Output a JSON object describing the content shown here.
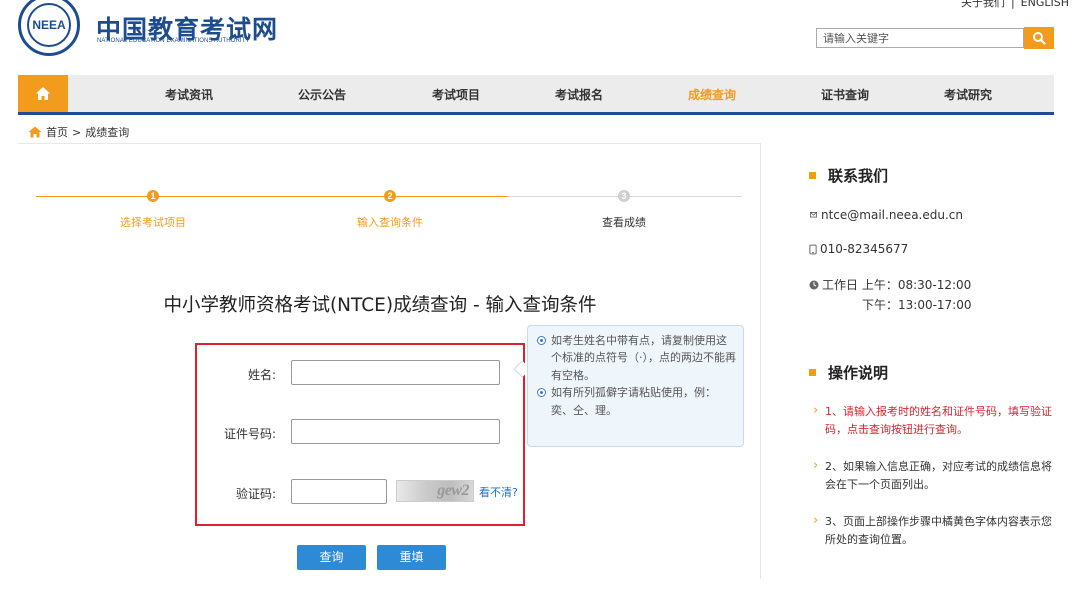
{
  "header": {
    "top_links": [
      "关于我们",
      "ENGLISH"
    ],
    "top_sep": "|",
    "logo_text": "NEEA",
    "site_title": "中国教育考试网",
    "site_subtitle": "NATIONAL EDUCATION EXAMINATIONS AUTHORITY",
    "search_placeholder": "请输入关键字"
  },
  "nav": {
    "items": [
      {
        "label": "考试资讯"
      },
      {
        "label": "公示公告"
      },
      {
        "label": "考试项目"
      },
      {
        "label": "考试报名"
      },
      {
        "label": "成绩查询"
      },
      {
        "label": "证书查询"
      },
      {
        "label": "考试研究"
      }
    ],
    "active": "成绩查询"
  },
  "breadcrumb": {
    "home": "首页",
    "sep": ">",
    "current": "成绩查询"
  },
  "steps": [
    {
      "num": "1",
      "label": "选择考试项目",
      "state": "done"
    },
    {
      "num": "2",
      "label": "输入查询条件",
      "state": "current"
    },
    {
      "num": "3",
      "label": "查看成绩",
      "state": "todo"
    }
  ],
  "form": {
    "title": "中小学教师资格考试(NTCE)成绩查询 - 输入查询条件",
    "name_label": "姓名:",
    "id_label": "证件号码:",
    "captcha_label": "验证码:",
    "captcha_text": "gew2",
    "refresh_label": "看不清?",
    "submit_label": "查询",
    "reset_label": "重填"
  },
  "tips": [
    "如考生姓名中带有点，请复制使用这个标准的点符号（·），点的两边不能再有空格。",
    "如有所列孤僻字请粘贴使用，例：奕、仝、理。"
  ],
  "contact": {
    "title": "联系我们",
    "email": "ntce@mail.neea.edu.cn",
    "phone": "010-82345677",
    "hours_am": "工作日 上午：08:30-12:00",
    "hours_pm": "下午：13:00-17:00"
  },
  "instructions": {
    "title": "操作说明",
    "items": [
      "1、请输入报考时的姓名和证件号码，填写验证码，点击查询按钮进行查询。",
      "2、如果输入信息正确，对应考试的成绩信息将会在下一个页面列出。",
      "3、页面上部操作步骤中橘黄色字体内容表示您所处的查询位置。"
    ]
  },
  "colors": {
    "accent": "#f29b1d",
    "brand": "#1d4d8f",
    "link": "#2f8ad6",
    "alert": "#d9232e"
  }
}
